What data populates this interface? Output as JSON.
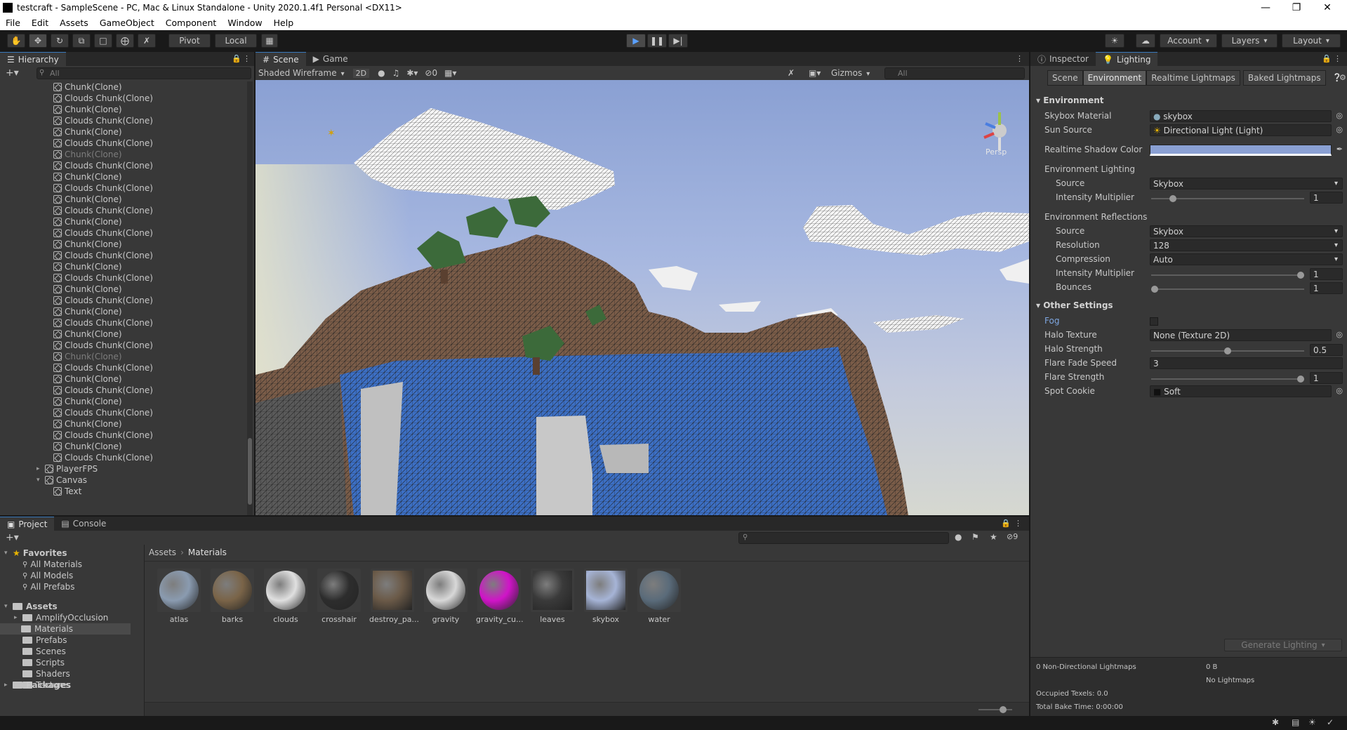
{
  "window": {
    "title": "testcraft - SampleScene - PC, Mac & Linux Standalone - Unity 2020.1.4f1 Personal <DX11>"
  },
  "menu": [
    "File",
    "Edit",
    "Assets",
    "GameObject",
    "Component",
    "Window",
    "Help"
  ],
  "toolbar": {
    "pivot": "Pivot",
    "local": "Local",
    "account": "Account",
    "layers": "Layers",
    "layout": "Layout"
  },
  "hierarchy": {
    "tab": "Hierarchy",
    "search_placeholder": "All",
    "rows": [
      {
        "label": "Chunk(Clone)",
        "dim": false
      },
      {
        "label": "Clouds Chunk(Clone)",
        "dim": false
      },
      {
        "label": "Chunk(Clone)",
        "dim": false
      },
      {
        "label": "Clouds Chunk(Clone)",
        "dim": false
      },
      {
        "label": "Chunk(Clone)",
        "dim": false
      },
      {
        "label": "Clouds Chunk(Clone)",
        "dim": false
      },
      {
        "label": "Chunk(Clone)",
        "dim": true
      },
      {
        "label": "Clouds Chunk(Clone)",
        "dim": false
      },
      {
        "label": "Chunk(Clone)",
        "dim": false
      },
      {
        "label": "Clouds Chunk(Clone)",
        "dim": false
      },
      {
        "label": "Chunk(Clone)",
        "dim": false
      },
      {
        "label": "Clouds Chunk(Clone)",
        "dim": false
      },
      {
        "label": "Chunk(Clone)",
        "dim": false
      },
      {
        "label": "Clouds Chunk(Clone)",
        "dim": false
      },
      {
        "label": "Chunk(Clone)",
        "dim": false
      },
      {
        "label": "Clouds Chunk(Clone)",
        "dim": false
      },
      {
        "label": "Chunk(Clone)",
        "dim": false
      },
      {
        "label": "Clouds Chunk(Clone)",
        "dim": false
      },
      {
        "label": "Chunk(Clone)",
        "dim": false
      },
      {
        "label": "Clouds Chunk(Clone)",
        "dim": false
      },
      {
        "label": "Chunk(Clone)",
        "dim": false
      },
      {
        "label": "Clouds Chunk(Clone)",
        "dim": false
      },
      {
        "label": "Chunk(Clone)",
        "dim": false
      },
      {
        "label": "Clouds Chunk(Clone)",
        "dim": false
      },
      {
        "label": "Chunk(Clone)",
        "dim": true
      },
      {
        "label": "Clouds Chunk(Clone)",
        "dim": false
      },
      {
        "label": "Chunk(Clone)",
        "dim": false
      },
      {
        "label": "Clouds Chunk(Clone)",
        "dim": false
      },
      {
        "label": "Chunk(Clone)",
        "dim": false
      },
      {
        "label": "Clouds Chunk(Clone)",
        "dim": false
      },
      {
        "label": "Chunk(Clone)",
        "dim": false
      },
      {
        "label": "Clouds Chunk(Clone)",
        "dim": false
      },
      {
        "label": "Chunk(Clone)",
        "dim": false
      },
      {
        "label": "Clouds Chunk(Clone)",
        "dim": false
      }
    ],
    "tail": [
      {
        "label": "PlayerFPS"
      },
      {
        "label": "Canvas"
      },
      {
        "label": "Text"
      }
    ]
  },
  "scene": {
    "tabs": [
      "Scene",
      "Game"
    ],
    "shading": "Shaded Wireframe",
    "mode2d": "2D",
    "hidden_count": "0",
    "gizmos": "Gizmos",
    "search_placeholder": "All",
    "persp": "Persp"
  },
  "inspector": {
    "tabs": [
      "Inspector",
      "Lighting"
    ],
    "subtabs": [
      "Scene",
      "Environment",
      "Realtime Lightmaps",
      "Baked Lightmaps"
    ],
    "environment": {
      "header": "Environment",
      "skybox_label": "Skybox Material",
      "skybox_value": "skybox",
      "sun_label": "Sun Source",
      "sun_value": "Directional Light (Light)",
      "shadow_label": "Realtime Shadow Color",
      "shadow_color": "#8aa0d3",
      "lighting_header": "Environment Lighting",
      "source_label": "Source",
      "source_value": "Skybox",
      "intensity_label": "Intensity Multiplier",
      "intensity_value": "1",
      "intensity_level": 0.125,
      "refl_header": "Environment Reflections",
      "refl_source_label": "Source",
      "refl_source_value": "Skybox",
      "res_label": "Resolution",
      "res_value": "128",
      "comp_label": "Compression",
      "comp_value": "Auto",
      "refl_int_label": "Intensity Multiplier",
      "refl_int_value": "1",
      "refl_int_level": 1.0,
      "bounces_label": "Bounces",
      "bounces_value": "1",
      "bounces_level": 0.0
    },
    "other": {
      "header": "Other Settings",
      "fog_label": "Fog",
      "halo_tex_label": "Halo Texture",
      "halo_tex_value": "None (Texture 2D)",
      "halo_str_label": "Halo Strength",
      "halo_str_value": "0.5",
      "halo_str_level": 0.5,
      "flare_fade_label": "Flare Fade Speed",
      "flare_fade_value": "3",
      "flare_str_label": "Flare Strength",
      "flare_str_value": "1",
      "flare_str_level": 1.0,
      "spot_label": "Spot Cookie",
      "spot_value": "Soft"
    },
    "generate": "Generate Lighting",
    "stats": {
      "lightmaps": "0 Non-Directional Lightmaps",
      "size": "0 B",
      "none": "No Lightmaps",
      "texels": "Occupied Texels: 0.0",
      "bake": "Total Bake Time: 0:00:00"
    }
  },
  "project": {
    "tabs": [
      "Project",
      "Console"
    ],
    "hidden_count": "9",
    "breadcrumb": [
      "Assets",
      "Materials"
    ],
    "favorites": {
      "label": "Favorites",
      "items": [
        "All Materials",
        "All Models",
        "All Prefabs"
      ]
    },
    "assets": {
      "label": "Assets",
      "items": [
        "AmplifyOcclusion",
        "Materials",
        "Prefabs",
        "Scenes",
        "Scripts",
        "Shaders",
        "Textures"
      ]
    },
    "packages": "Packages",
    "materials": [
      {
        "name": "atlas",
        "color": "#8a9bb0"
      },
      {
        "name": "barks",
        "color": "#7a6448"
      },
      {
        "name": "clouds",
        "color": "#e0e0e0"
      },
      {
        "name": "crosshair",
        "color": "#2d2d2d"
      },
      {
        "name": "destroy_pa...",
        "color": "#6b5a48"
      },
      {
        "name": "gravity",
        "color": "#d8d8d8"
      },
      {
        "name": "gravity_cu...",
        "color": "#d014c8"
      },
      {
        "name": "leaves",
        "color": "#3a3a3a"
      },
      {
        "name": "skybox",
        "color": "#a6b4d6"
      },
      {
        "name": "water",
        "color": "#5a6b7a"
      }
    ]
  }
}
